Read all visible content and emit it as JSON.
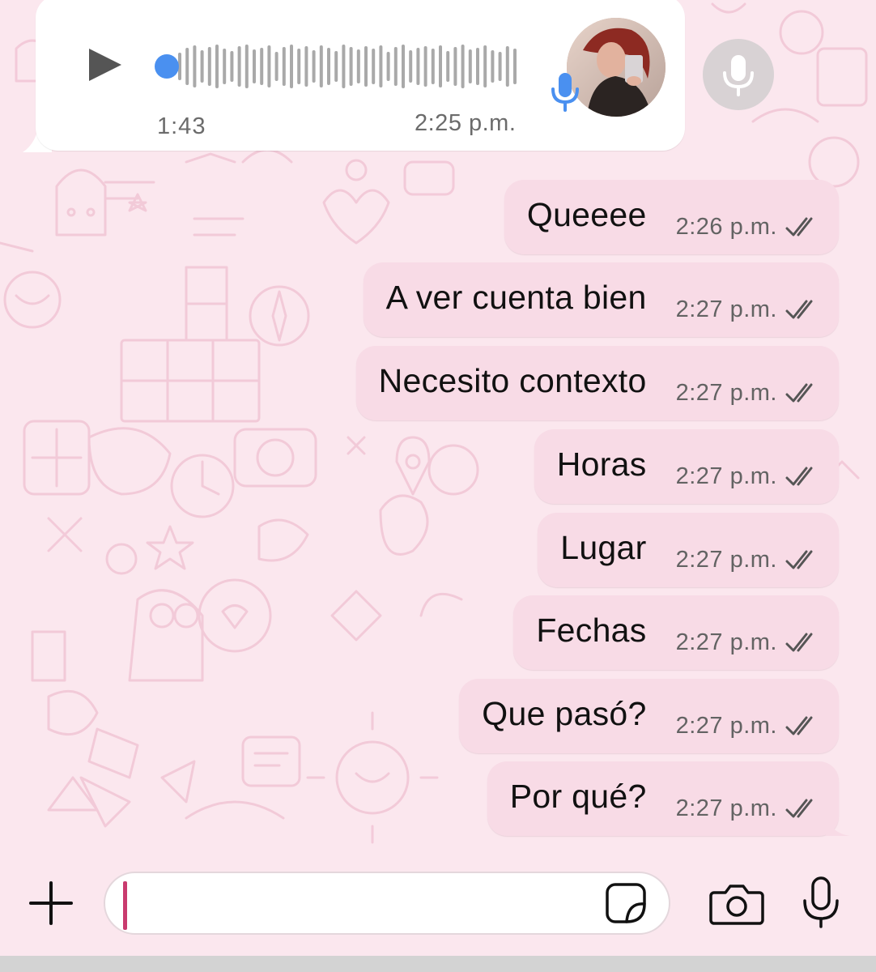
{
  "voice_message": {
    "duration": "1:43",
    "time": "2:25 p.m.",
    "play_icon": "play-icon",
    "mic_icon": "mic-icon"
  },
  "messages": [
    {
      "text": "Queeee",
      "time": "2:26 p.m.",
      "status": "delivered"
    },
    {
      "text": "A ver cuenta bien",
      "time": "2:27 p.m.",
      "status": "delivered"
    },
    {
      "text": "Necesito contexto",
      "time": "2:27 p.m.",
      "status": "delivered"
    },
    {
      "text": "Horas",
      "time": "2:27 p.m.",
      "status": "delivered"
    },
    {
      "text": "Lugar",
      "time": "2:27 p.m.",
      "status": "delivered"
    },
    {
      "text": "Fechas",
      "time": "2:27 p.m.",
      "status": "delivered"
    },
    {
      "text": "Que pasó?",
      "time": "2:27 p.m.",
      "status": "delivered"
    },
    {
      "text": "Por qué?",
      "time": "2:27 p.m.",
      "status": "delivered"
    }
  ],
  "composer": {
    "value": "",
    "placeholder": "",
    "icons": [
      "plus-icon",
      "sticker-icon",
      "camera-icon",
      "mic-icon"
    ]
  },
  "colors": {
    "chat_background": "#fbe7ee",
    "sent_bubble": "#f8dbe6",
    "received_bubble": "#ffffff",
    "progress_dot": "#4a90f0",
    "cursor": "#c93b6e"
  }
}
